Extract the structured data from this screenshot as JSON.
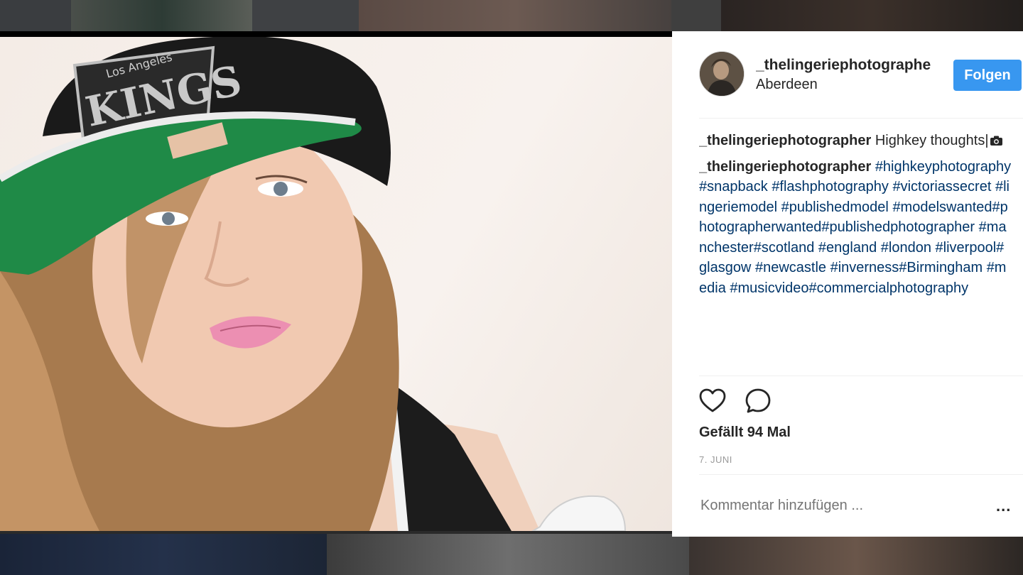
{
  "post": {
    "username": "_thelingeriephotographer",
    "location": "Aberdeen",
    "follow_label": "Folgen",
    "caption": {
      "user": "_thelingeriephotographer",
      "text": "Highkey thoughts|"
    },
    "hashtag_comment": {
      "user": "_thelingeriephotographer",
      "tags": [
        "#highkeyphotography",
        " ",
        "#snapback",
        " ",
        "#flashphotography",
        " ",
        "#victoriassecret",
        " ",
        "#lingeriemodel",
        " ",
        "#publishedmodel",
        " ",
        "#modelswanted",
        "#photographerwanted",
        "#publishedphotographer",
        " ",
        "#manchester",
        "#scotland",
        " ",
        "#england",
        " ",
        "#london",
        " ",
        "#liverpool",
        "#glasgow",
        " ",
        "#newcastle",
        " ",
        "#inverness",
        "#Birmingham",
        " ",
        "#media",
        " ",
        "#musicvideo",
        "#commercialphotography"
      ]
    },
    "likes_text": "Gefällt 94 Mal",
    "date_text": "7. JUNI",
    "comment_placeholder": "Kommentar hinzufügen ...",
    "more_label": "..."
  },
  "photo": {
    "cap_text": "KINGS",
    "cap_small_text": "Los Angeles"
  },
  "icons": {
    "like": "heart-icon",
    "comment": "speech-bubble-icon",
    "camera": "camera-icon"
  },
  "colors": {
    "follow_button": "#3897f0",
    "hashtag": "#003569",
    "text": "#262626",
    "muted": "#999999"
  }
}
